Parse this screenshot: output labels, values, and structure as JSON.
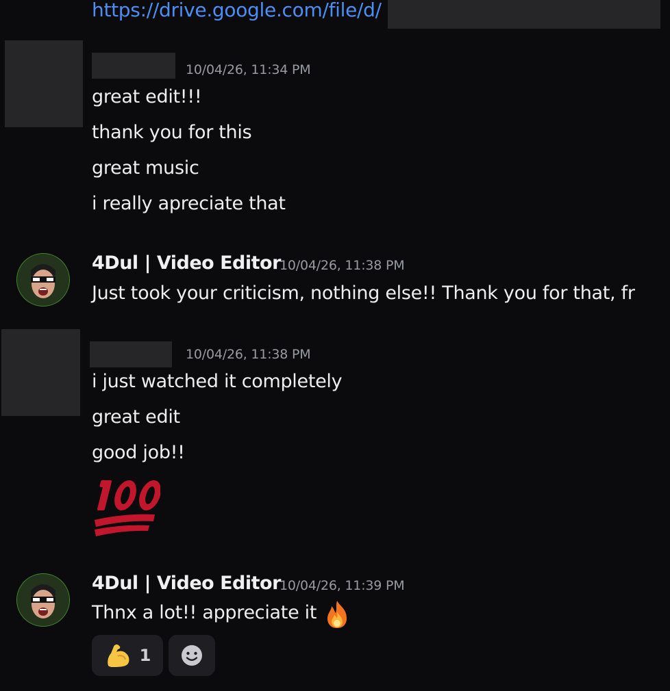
{
  "link_message": {
    "url_text": "https://drive.google.com/file/d/"
  },
  "messages": [
    {
      "timestamp": "10/04/26, 11:34 PM",
      "lines": [
        "great edit!!!",
        "thank you for this",
        "great music",
        "i really apreciate that"
      ]
    },
    {
      "username": "4Dul | Video Editor",
      "timestamp": "10/04/26, 11:38 PM",
      "lines": [
        "Just took your criticism, nothing else!! Thank you for that, fr"
      ]
    },
    {
      "timestamp": "10/04/26, 11:38 PM",
      "lines": [
        "i just watched it completely",
        "great edit",
        "good job!!"
      ],
      "emoji": "100-emoji"
    },
    {
      "username": "4Dul | Video Editor",
      "timestamp": "10/04/26, 11:39 PM",
      "lines": [
        "Thnx a lot!! appreciate it"
      ],
      "inline_emoji": "fire-emoji",
      "reactions": [
        {
          "icon": "flexed-biceps-emoji",
          "count": "1"
        },
        {
          "icon": "add-reaction-smiley-icon"
        }
      ]
    }
  ],
  "colors": {
    "background": "#0b0b0d",
    "link": "#4c8ef5",
    "redaction": "#262628",
    "timestamp": "#9a9aa3",
    "avatar_ring": "#3f8a2c"
  }
}
